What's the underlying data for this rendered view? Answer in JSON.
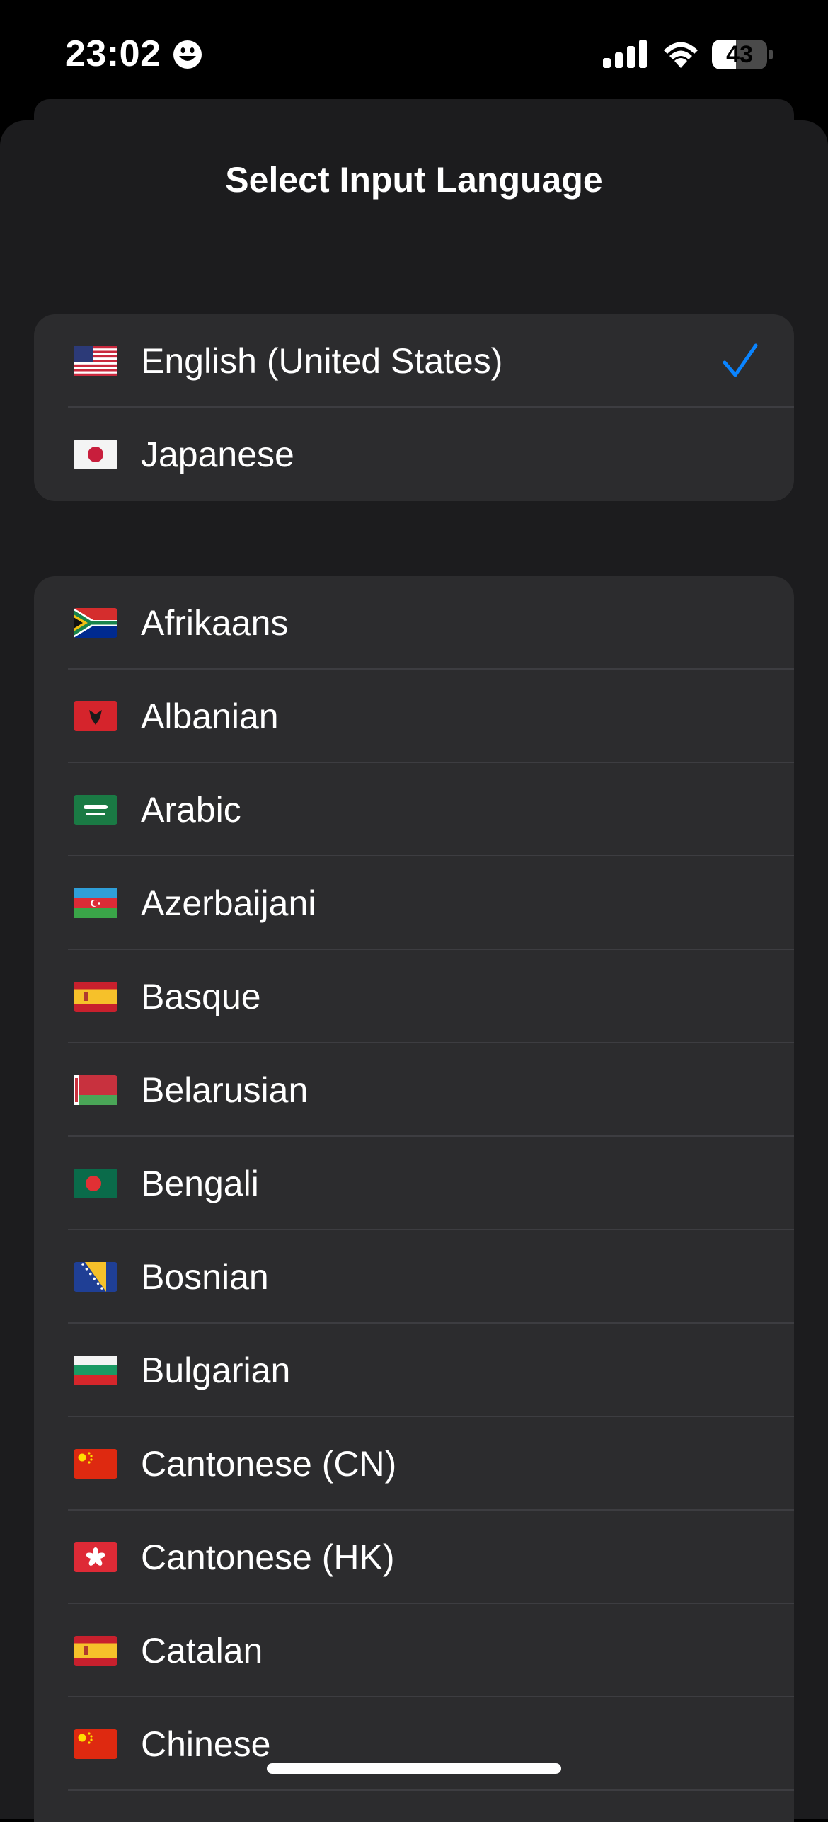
{
  "status_bar": {
    "time": "23:02",
    "focus_icon": "smiling-face-icon",
    "battery_level": "43",
    "battery_fraction": 0.43
  },
  "sheet": {
    "title": "Select Input Language"
  },
  "selected_languages": [
    {
      "label": "English (United States)",
      "flag": "us-flag-icon",
      "selected": true
    },
    {
      "label": "Japanese",
      "flag": "jp-flag-icon",
      "selected": false
    }
  ],
  "languages": [
    {
      "label": "Afrikaans",
      "flag": "za-flag-icon"
    },
    {
      "label": "Albanian",
      "flag": "al-flag-icon"
    },
    {
      "label": "Arabic",
      "flag": "sa-flag-icon"
    },
    {
      "label": "Azerbaijani",
      "flag": "az-flag-icon"
    },
    {
      "label": "Basque",
      "flag": "es-flag-icon"
    },
    {
      "label": "Belarusian",
      "flag": "by-flag-icon"
    },
    {
      "label": "Bengali",
      "flag": "bd-flag-icon"
    },
    {
      "label": "Bosnian",
      "flag": "ba-flag-icon"
    },
    {
      "label": "Bulgarian",
      "flag": "bg-flag-icon"
    },
    {
      "label": "Cantonese (CN)",
      "flag": "cn-flag-icon"
    },
    {
      "label": "Cantonese (HK)",
      "flag": "hk-flag-icon"
    },
    {
      "label": "Catalan",
      "flag": "es-flag-icon"
    },
    {
      "label": "Chinese",
      "flag": "cn-flag-icon"
    }
  ],
  "colors": {
    "background": "#000000",
    "sheet": "#1c1c1e",
    "cell": "#2c2c2e",
    "separator": "#3d3d41",
    "accent": "#0a84ff"
  }
}
